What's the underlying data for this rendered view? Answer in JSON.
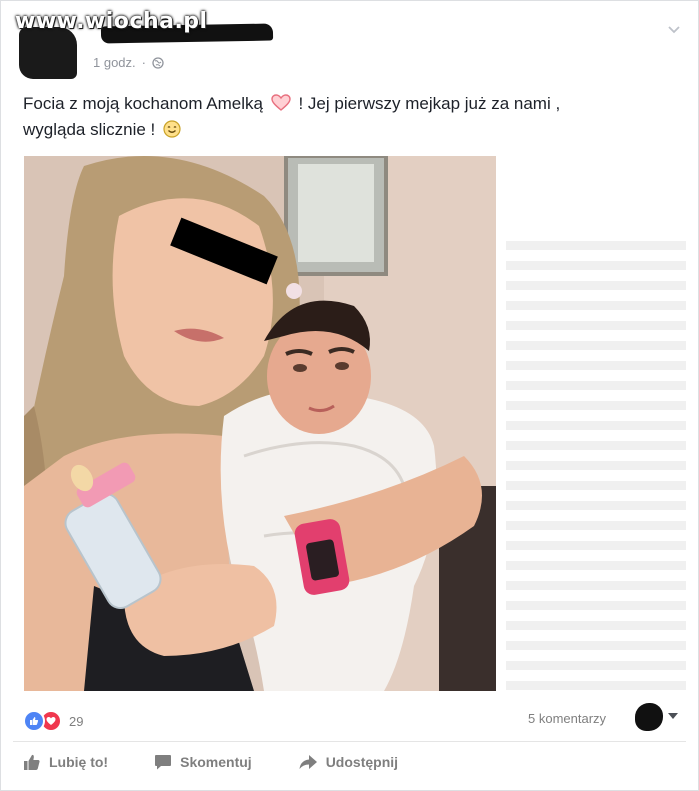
{
  "watermark": "www.wiocha.pl",
  "post": {
    "timestamp": "1 godz.",
    "text_part1": "Focia z moją kochanom Amelką",
    "text_part2": "! Jej pierwszy mejkap już za nami ,",
    "text_part3": "wygląda slicznie !"
  },
  "footer": {
    "reactions_count": "29",
    "comments_label": "5 komentarzy"
  },
  "actions": {
    "like": "Lubię to!",
    "comment": "Skomentuj",
    "share": "Udostępnij"
  },
  "colors": {
    "like_blue": "#4e84f5",
    "love_red": "#f0374e",
    "muted_text": "#90949c"
  },
  "icons": {
    "heart": "heart-emoji-icon",
    "smile": "smile-emoji-icon",
    "globe": "globe-icon"
  }
}
